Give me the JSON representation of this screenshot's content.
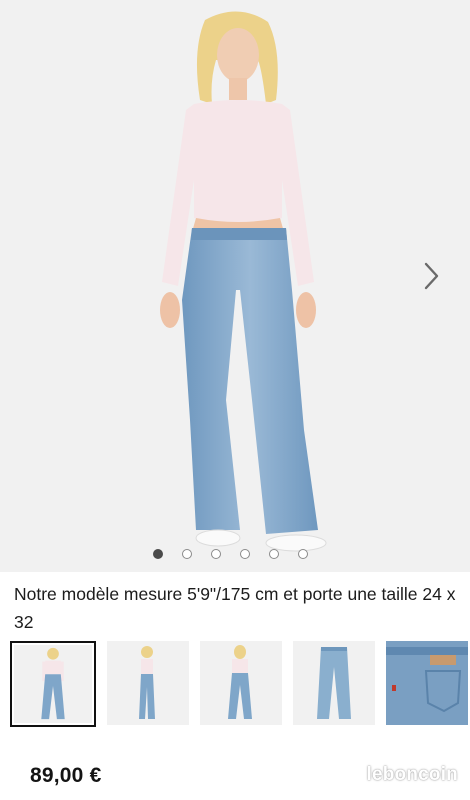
{
  "gallery": {
    "main_image": "model-wearing-flare-jeans-photo",
    "next_icon": "chevron-right-icon",
    "dots_total": 6,
    "active_dot": 0,
    "thumbnails": [
      {
        "image": "front-view-photo",
        "selected": true
      },
      {
        "image": "side-view-photo",
        "selected": false
      },
      {
        "image": "back-view-photo",
        "selected": false
      },
      {
        "image": "jeans-flat-photo",
        "selected": false
      },
      {
        "image": "jeans-back-pocket-detail-photo",
        "selected": false
      }
    ]
  },
  "caption": "Notre modèle mesure 5'9\"/175 cm et porte une taille 24 x 32",
  "price": "89,00 €",
  "watermark": "leboncoin",
  "colors": {
    "denim": "#7fa6c9",
    "top": "#f6e6e9",
    "hair": "#ecd28a",
    "background": "#f1f1f1"
  }
}
